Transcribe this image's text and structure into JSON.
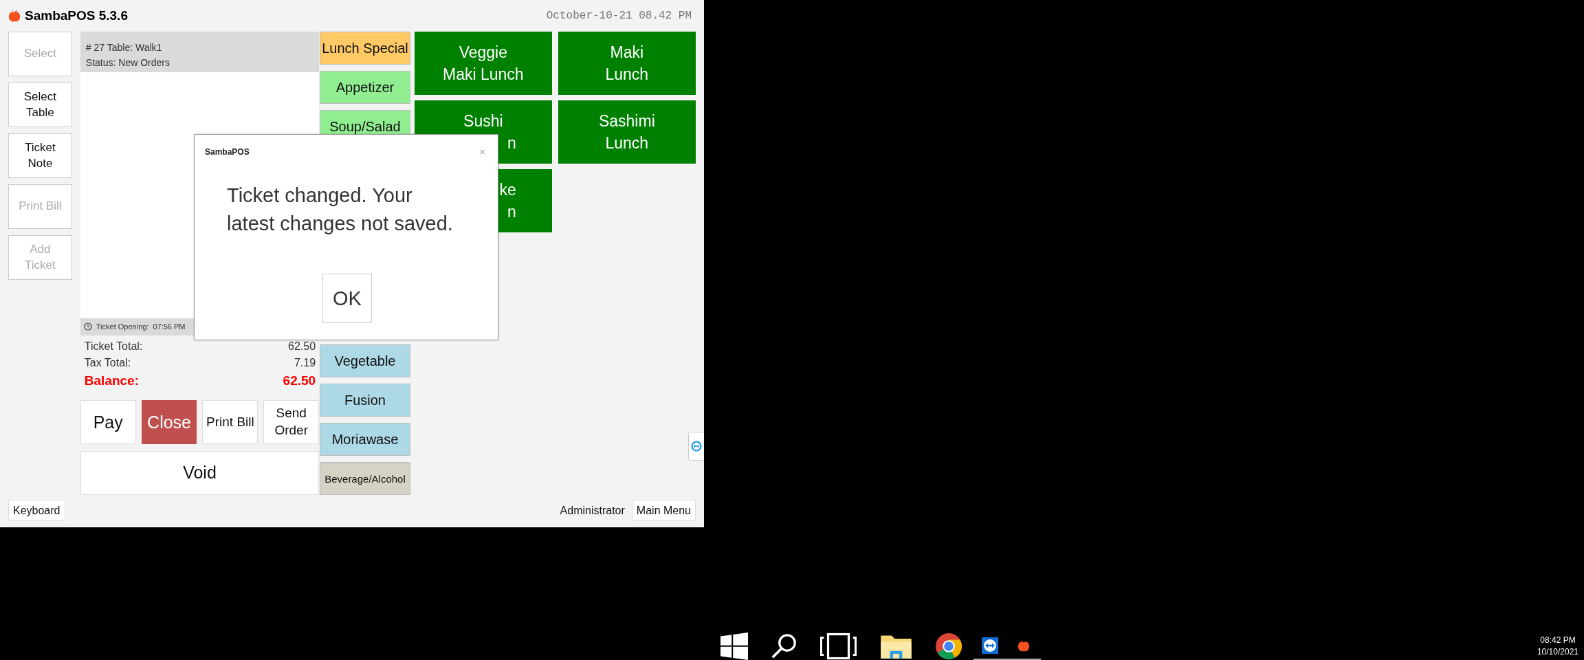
{
  "window": {
    "title": "SambaPOS 5.3.6",
    "clock": "October-10-21 08.42 PM"
  },
  "side_buttons": [
    {
      "label": "Select",
      "disabled": true
    },
    {
      "label": "Select Table",
      "disabled": false
    },
    {
      "label": "Ticket Note",
      "disabled": false
    },
    {
      "label": "Print Bill",
      "disabled": true
    },
    {
      "label": "Add Ticket",
      "disabled": true
    }
  ],
  "ticket": {
    "header": [
      "# 27 Table: Walk1",
      "Status: New Orders"
    ],
    "opening_label": "Ticket Opening:",
    "opening_time": "07:56 PM",
    "totals": [
      {
        "label": "Ticket Total:",
        "value": "62.50",
        "kind": "normal"
      },
      {
        "label": "Tax Total:",
        "value": "7.19",
        "kind": "normal"
      },
      {
        "label": "Balance:",
        "value": "62.50",
        "kind": "balance"
      }
    ]
  },
  "actions": [
    {
      "label": "Pay",
      "kind": "plain"
    },
    {
      "label": "Close",
      "kind": "danger"
    },
    {
      "label": "Print Bill",
      "kind": "small"
    },
    {
      "label": "Send Order",
      "kind": "small"
    }
  ],
  "void_button": "Void",
  "categories_top": [
    {
      "label": "Lunch Special",
      "color": "#ffc966"
    },
    {
      "label": "Appetizer",
      "color": "#90ee90"
    },
    {
      "label": "Soup/Salad",
      "color": "#90ee90"
    }
  ],
  "categories_bottom": [
    {
      "label": "Vegetable",
      "color": "#add8e6"
    },
    {
      "label": "Fusion",
      "color": "#add8e6"
    },
    {
      "label": "Moriawase",
      "color": "#add8e6"
    },
    {
      "label": "Beverage/Alcohol",
      "color": "#d6d3c6"
    }
  ],
  "products": [
    {
      "lines": [
        {
          "text": "Veggie",
          "clipped": false
        },
        {
          "text": "Maki Lunch",
          "clipped": false
        }
      ]
    },
    {
      "lines": [
        {
          "text": "Maki",
          "clipped": false
        },
        {
          "text": "Lunch",
          "clipped": false
        }
      ]
    },
    {
      "lines": [
        {
          "text": "Sushi",
          "clipped": false
        },
        {
          "text": "n",
          "clipped": true
        }
      ]
    },
    {
      "lines": [
        {
          "text": "Sashimi",
          "clipped": false
        },
        {
          "text": "Lunch",
          "clipped": false
        }
      ]
    },
    {
      "lines": [
        {
          "text": "ke",
          "clipped": true
        },
        {
          "text": "n",
          "clipped": true
        }
      ]
    }
  ],
  "footer": {
    "keyboard": "Keyboard",
    "user": "Administrator",
    "main_menu": "Main Menu"
  },
  "dialog": {
    "title": "SambaPOS",
    "close": "×",
    "message": "Ticket changed. Your latest changes not saved.",
    "ok": "OK"
  },
  "taskbar": {
    "time": "08:42 PM",
    "date": "10/10/2021"
  }
}
